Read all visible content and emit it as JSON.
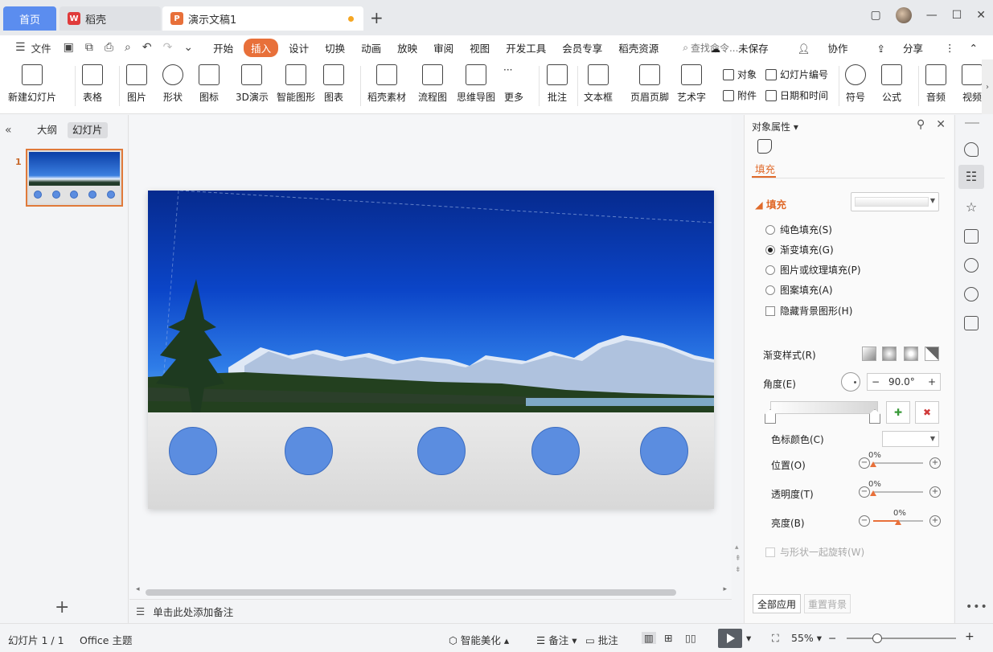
{
  "titlebar": {
    "home_tab": "首页",
    "wps_tab": "稻壳",
    "doc_tab": "演示文稿1",
    "new_tab": "+"
  },
  "menubar": {
    "file": "文件",
    "items": [
      "开始",
      "插入",
      "设计",
      "切换",
      "动画",
      "放映",
      "审阅",
      "视图",
      "开发工具",
      "会员专享",
      "稻壳资源"
    ],
    "active_index": 1,
    "search_placeholder": "查找命令...",
    "unsaved": "未保存",
    "collab": "协作",
    "share": "分享"
  },
  "ribbon": {
    "new_slide": "新建幻灯片",
    "table": "表格",
    "picture": "图片",
    "shape": "形状",
    "icon": "图标",
    "d3": "3D演示",
    "smart_graphic": "智能图形",
    "chart": "图表",
    "daoke_material": "稻壳素材",
    "flowchart": "流程图",
    "mindmap": "思维导图",
    "more": "更多",
    "comment": "批注",
    "textbox": "文本框",
    "header_footer": "页眉页脚",
    "wordart": "艺术字",
    "object": "对象",
    "attachment": "附件",
    "slide_number": "幻灯片编号",
    "datetime": "日期和时间",
    "symbol": "符号",
    "formula": "公式",
    "audio": "音频",
    "video": "视频"
  },
  "leftpanel": {
    "outline_tab": "大纲",
    "slides_tab": "幻灯片",
    "slide_number": "1",
    "add": "+"
  },
  "notes": {
    "placeholder": "单击此处添加备注"
  },
  "properties": {
    "title": "对象属性",
    "fill_tab": "填充",
    "section": "填充",
    "options": [
      "纯色填充(S)",
      "渐变填充(G)",
      "图片或纹理填充(P)",
      "图案填充(A)"
    ],
    "selected_option": 1,
    "hide_bg": "隐藏背景图形(H)",
    "gradient_style": "渐变样式(R)",
    "angle_label": "角度(E)",
    "angle_value": "90.0°",
    "stop_color": "色标颜色(C)",
    "position": "位置(O)",
    "transparency": "透明度(T)",
    "brightness": "亮度(B)",
    "position_value": "0%",
    "transparency_value": "0%",
    "brightness_value": "0%",
    "position_level": 0,
    "transparency_level": 0,
    "brightness_level": 0.5,
    "rotate_with_shape": "与形状一起旋转(W)",
    "apply_all": "全部应用",
    "reset_bg": "重置背景"
  },
  "slide": {
    "circle_count": 5,
    "circle_color": "#5b8de0"
  },
  "status": {
    "slide_info": "幻灯片 1 / 1",
    "theme": "Office 主题",
    "smart_beautify": "智能美化",
    "notes": "备注",
    "comments": "批注",
    "zoom": "55%",
    "zoom_level": 0.28,
    "zoom_minus": "−",
    "zoom_plus": "+"
  },
  "colors": {
    "accent_orange": "#e8703a",
    "home_blue": "#5b8def"
  }
}
